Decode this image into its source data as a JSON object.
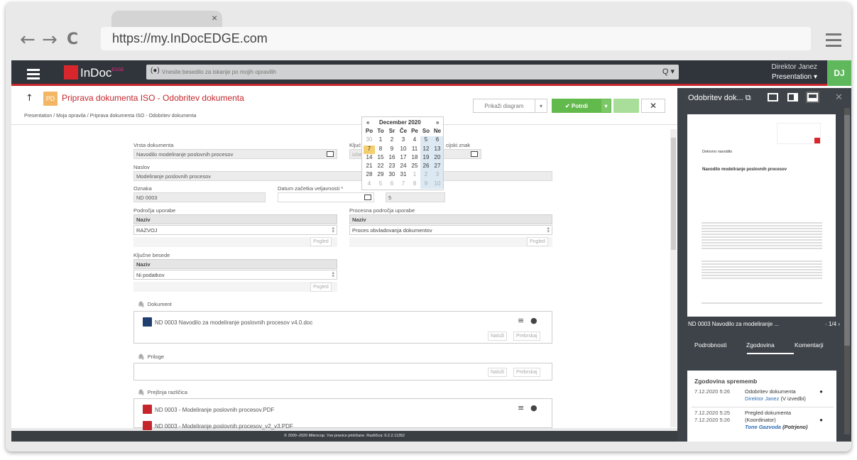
{
  "browser": {
    "tab_close": "×",
    "back": "←",
    "forward": "→",
    "reload": "C",
    "url": "https://my.InDocEDGE.com"
  },
  "topbar": {
    "logo_text": "InDoc",
    "logo_sup": "EDGE",
    "search_placeholder": "Vnesite besedilo za iskanje po mojih opravilih",
    "search_icon": "Q",
    "user_name": "Direktor Janez",
    "user_context": "Presentation ▾",
    "avatar_initials": "DJ"
  },
  "header": {
    "up_icon": "↑",
    "badge": "PD",
    "title": "Priprava dokumenta ISO - Odobritev dokumenta",
    "breadcrumb": "Presentation  /  Moja opravila  /  Priprava dokumenta ISO - Odobritev dokumenta",
    "btn_diagram": "Prikaži diagram",
    "btn_dropdown": "▾",
    "btn_confirm": "✔  Potrdi",
    "btn_confirm_dd": "▾",
    "btn_close": "✕"
  },
  "form": {
    "vrsta_label": "Vrsta dokumenta",
    "vrsta_value": "Navodilo modeliranje poslovnih procesov",
    "kljuc_label": "Kljuć",
    "klas_label": "cijski znak",
    "klas_value": "izbe",
    "naslov_label": "Naslov",
    "naslov_value": "Modeliranje poslovnih procesov",
    "oznaka_label": "Oznaka",
    "oznaka_value": "ND 0003",
    "datum_label": "Datum začetka veljavnosti *",
    "rev_value": "5",
    "podrocja_label": "Področja uporabe",
    "col_naziv": "Naziv",
    "podrocja_value": "RAZVOJ",
    "pogled": "Pogled",
    "procesna_label": "Procesna področja uporabe",
    "procesna_value": "Proces obvladovanja dokumentov",
    "kljucne_label": "Ključne besede",
    "kljucne_value": "Ni podatkov",
    "dokument_label": "Dokument",
    "dokument_file": "ND 0003 Navodilo za modeliranje poslovnih procesov v4.0.doc",
    "nalozi": "Naloži",
    "prebrskaj": "Prebrskaj",
    "priloge_label": "Priloge",
    "prejsnja_label": "Prejšnja različica",
    "prejsnja_1": "ND 0003 - Modeliranje poslovnih procesov.PDF",
    "prejsnja_2": "ND 0003 - Modeliranje poslovnih procesov_v2_v3.PDF"
  },
  "calendar": {
    "prev": "«",
    "next": "»",
    "title": "December 2020",
    "weekdays": [
      "Po",
      "To",
      "Sr",
      "Če",
      "Pe",
      "So",
      "Ne"
    ],
    "days": [
      [
        "30",
        "1",
        "2",
        "3",
        "4",
        "5",
        "6"
      ],
      [
        "7",
        "8",
        "9",
        "10",
        "11",
        "12",
        "13"
      ],
      [
        "14",
        "15",
        "16",
        "17",
        "18",
        "19",
        "20"
      ],
      [
        "21",
        "22",
        "23",
        "24",
        "25",
        "26",
        "27"
      ],
      [
        "28",
        "29",
        "30",
        "31",
        "1",
        "2",
        "3"
      ],
      [
        "4",
        "5",
        "6",
        "7",
        "8",
        "9",
        "10"
      ]
    ]
  },
  "footer": {
    "text": "© 2000–2020 Mikrocop. Vse pravice pridržane.  Različica:  6.2.2.11352"
  },
  "right_panel": {
    "title": "Odobritev dok...",
    "preview_heading": "Delovno navodilo",
    "preview_title": "Navodilo modeliranje poslovnih procesov",
    "page_name": "ND 0003 Navodilo za modeliranje ...",
    "page_no": "1/4",
    "tabs": [
      "Podrobnosti",
      "Zgodovina",
      "Komentarji"
    ],
    "history_title": "Zgodovina sprememb",
    "history": [
      {
        "date": "7.12.2020 5:26",
        "action": "Odobritev dokumenta",
        "who": "Direktor Janez",
        "status": "(V izvedbi)"
      },
      {
        "date": "7.12.2020 5:25",
        "date2": "7.12.2020 5:26",
        "action": "Pregled dokumenta",
        "action2": "(Koordinator)",
        "who": "Tone Gazvoda",
        "status": "(Potrjeno)"
      }
    ]
  }
}
